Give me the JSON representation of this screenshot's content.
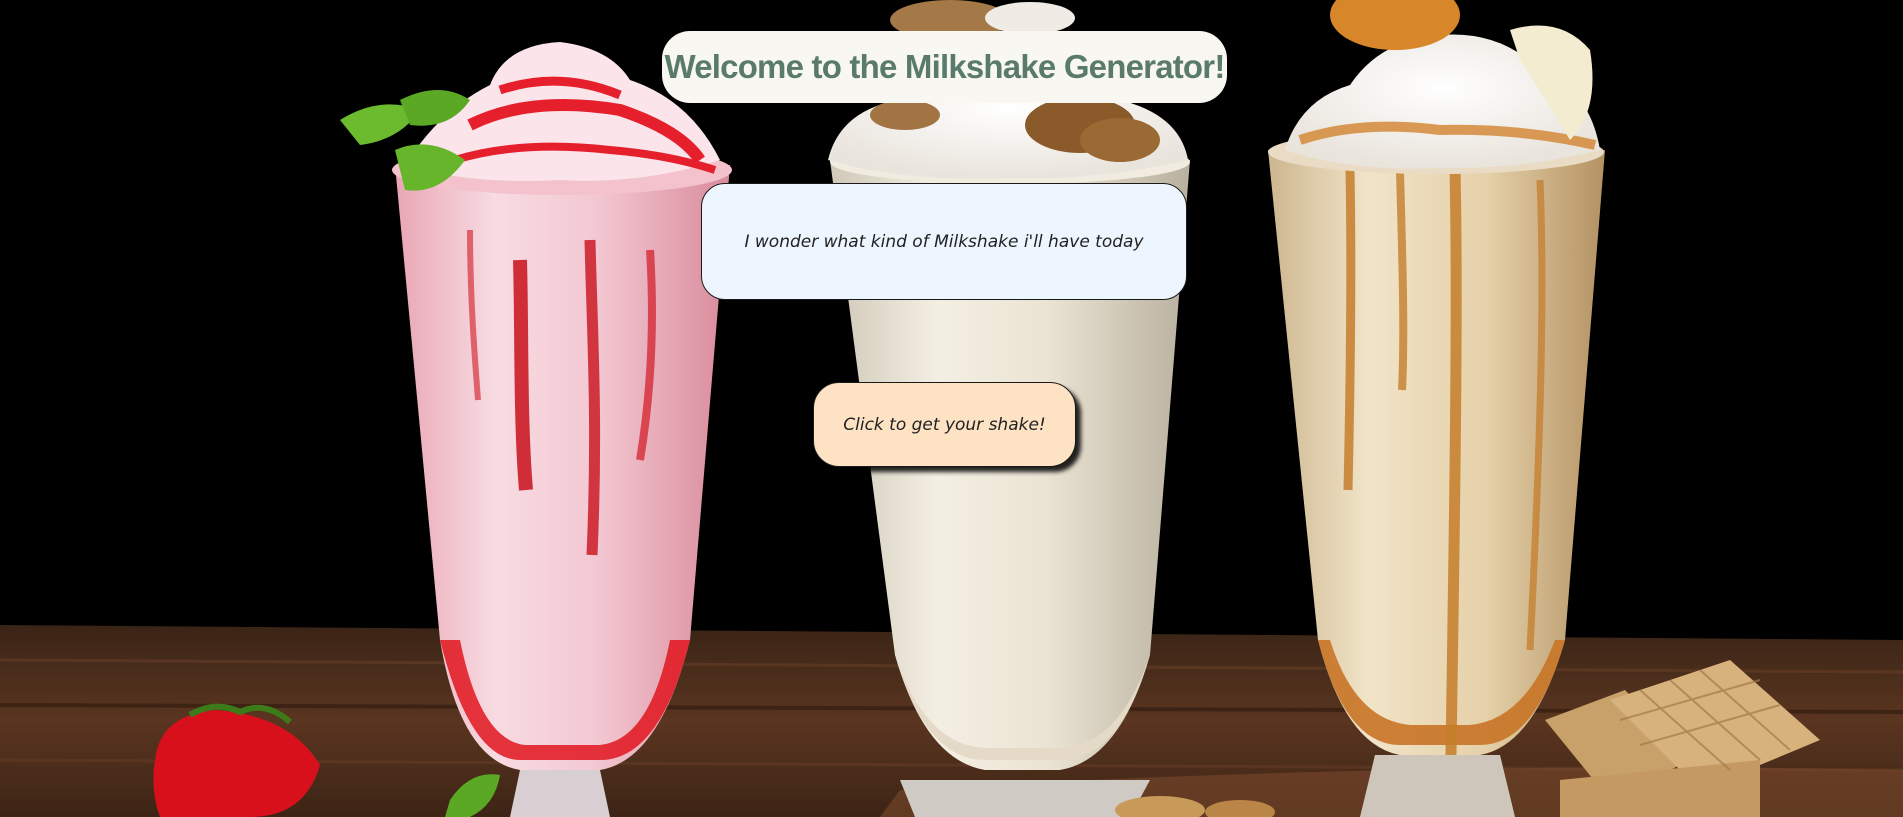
{
  "header": {
    "title": "Welcome to the Milkshake Generator!"
  },
  "message": {
    "text": "I wonder what kind of Milkshake i'll have today"
  },
  "action": {
    "button_label": "Click to get your shake!"
  },
  "background": {
    "subject": "three-milkshakes-photo"
  },
  "colors": {
    "title_text": "#5a7a6b",
    "title_bg": "#f8f7f1",
    "message_bg": "#edf6ff",
    "button_bg": "#fde2c4"
  }
}
